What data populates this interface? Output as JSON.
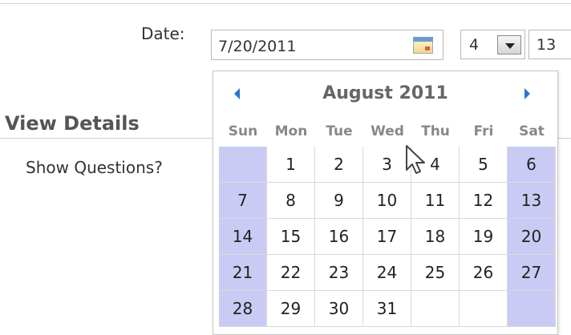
{
  "form": {
    "date_label": "Date:",
    "date_value": "7/20/2011",
    "hour_value": "4",
    "minute_value": "13",
    "view_details": "View Details",
    "show_questions": "Show Questions?"
  },
  "calendar": {
    "month_title": "August 2011",
    "days_of_week": [
      "Sun",
      "Mon",
      "Tue",
      "Wed",
      "Thu",
      "Fri",
      "Sat"
    ],
    "weeks": [
      [
        "",
        "1",
        "2",
        "3",
        "4",
        "5",
        "6"
      ],
      [
        "7",
        "8",
        "9",
        "10",
        "11",
        "12",
        "13"
      ],
      [
        "14",
        "15",
        "16",
        "17",
        "18",
        "19",
        "20"
      ],
      [
        "21",
        "22",
        "23",
        "24",
        "25",
        "26",
        "27"
      ],
      [
        "28",
        "29",
        "30",
        "31",
        "",
        "",
        ""
      ]
    ],
    "weekend_color": "#c9cbf4",
    "nav_arrow_color": "#2a78c7"
  },
  "icons": {
    "calendar_button": "calendar-icon",
    "hour_dropdown": "chevron-down-icon",
    "prev_month": "chevron-left-icon",
    "next_month": "chevron-right-icon",
    "cursor": "mouse-pointer-icon"
  }
}
